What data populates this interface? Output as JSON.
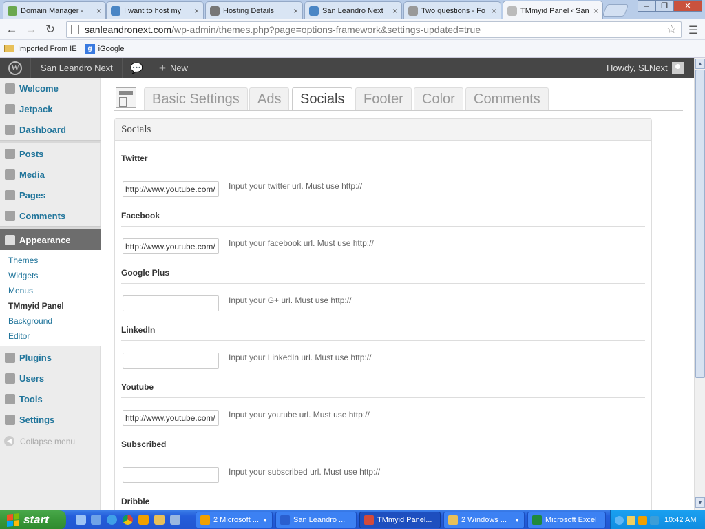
{
  "browser": {
    "tabs": [
      {
        "label": "Domain Manager - ",
        "icon_color": "#6aa84f"
      },
      {
        "label": "I want to host my ",
        "icon_color": "#4a86c5"
      },
      {
        "label": "Hosting Details",
        "icon_color": "#777777"
      },
      {
        "label": "San Leandro Next",
        "icon_color": "#4a86c5"
      },
      {
        "label": "Two questions - Fo",
        "icon_color": "#999999"
      },
      {
        "label": "TMmyid Panel ‹ San",
        "icon_color": "#bbbbbb"
      }
    ],
    "tab_close": "×",
    "url_host": "sanleandronext.com",
    "url_path": "/wp-admin/themes.php?page=options-framework&settings-updated=true",
    "bookmarks": [
      {
        "label": "Imported From IE"
      },
      {
        "label": "iGoogle"
      }
    ],
    "google_badge": "g",
    "window_controls": {
      "minimize": "–",
      "restore": "❐",
      "close": "✕"
    }
  },
  "adminbar": {
    "site_name": "San Leandro Next",
    "new_label": "New",
    "plus": "+",
    "howdy": "Howdy, SLNext",
    "wp_badge": "W"
  },
  "sidebar": {
    "items": [
      {
        "label": "Welcome"
      },
      {
        "label": "Jetpack"
      },
      {
        "label": "Dashboard"
      },
      {
        "label": "Posts"
      },
      {
        "label": "Media"
      },
      {
        "label": "Pages"
      },
      {
        "label": "Comments"
      },
      {
        "label": "Plugins"
      },
      {
        "label": "Users"
      },
      {
        "label": "Tools"
      },
      {
        "label": "Settings"
      }
    ],
    "active": "Appearance",
    "submenu": [
      "Themes",
      "Widgets",
      "Menus",
      "TMmyid Panel",
      "Background",
      "Editor"
    ],
    "collapse": "Collapse menu"
  },
  "main": {
    "tabs": [
      "Basic Settings",
      "Ads",
      "Socials",
      "Footer",
      "Color",
      "Comments"
    ],
    "active_tab": "Socials",
    "box_title": "Socials",
    "fields": [
      {
        "label": "Twitter",
        "value": "http://www.youtube.com/",
        "desc": "Input your twitter url. Must use http://"
      },
      {
        "label": "Facebook",
        "value": "http://www.youtube.com/",
        "desc": "Input your facebook url. Must use http://"
      },
      {
        "label": "Google Plus",
        "value": "",
        "desc": "Input your G+ url. Must use http://"
      },
      {
        "label": "LinkedIn",
        "value": "",
        "desc": "Input your LinkedIn url. Must use http://"
      },
      {
        "label": "Youtube",
        "value": "http://www.youtube.com/",
        "desc": "Input your youtube url. Must use http://"
      },
      {
        "label": "Subscribed",
        "value": "",
        "desc": "Input your subscribed url. Must use http://"
      },
      {
        "label": "Dribble",
        "value": "",
        "desc": ""
      }
    ]
  },
  "taskbar": {
    "start": "start",
    "tasks": [
      {
        "label": "2 Microsoft ...",
        "icon_color": "#f0a000",
        "group": true
      },
      {
        "label": "San Leandro ...",
        "icon_color": "#2a5fcf",
        "group": false
      },
      {
        "label": "TMmyid Panel...",
        "icon_color": "#d44a3a",
        "group": false
      },
      {
        "label": "2 Windows ...",
        "icon_color": "#e8c059",
        "group": true
      },
      {
        "label": "Microsoft Excel",
        "icon_color": "#1f8a3c",
        "group": false
      }
    ],
    "clock": "10:42 AM"
  },
  "colors": {
    "wp_link": "#21759b",
    "adminbar_bg": "#464646",
    "taskbar_blue": "#245edb",
    "start_green": "#3b9a3b"
  }
}
